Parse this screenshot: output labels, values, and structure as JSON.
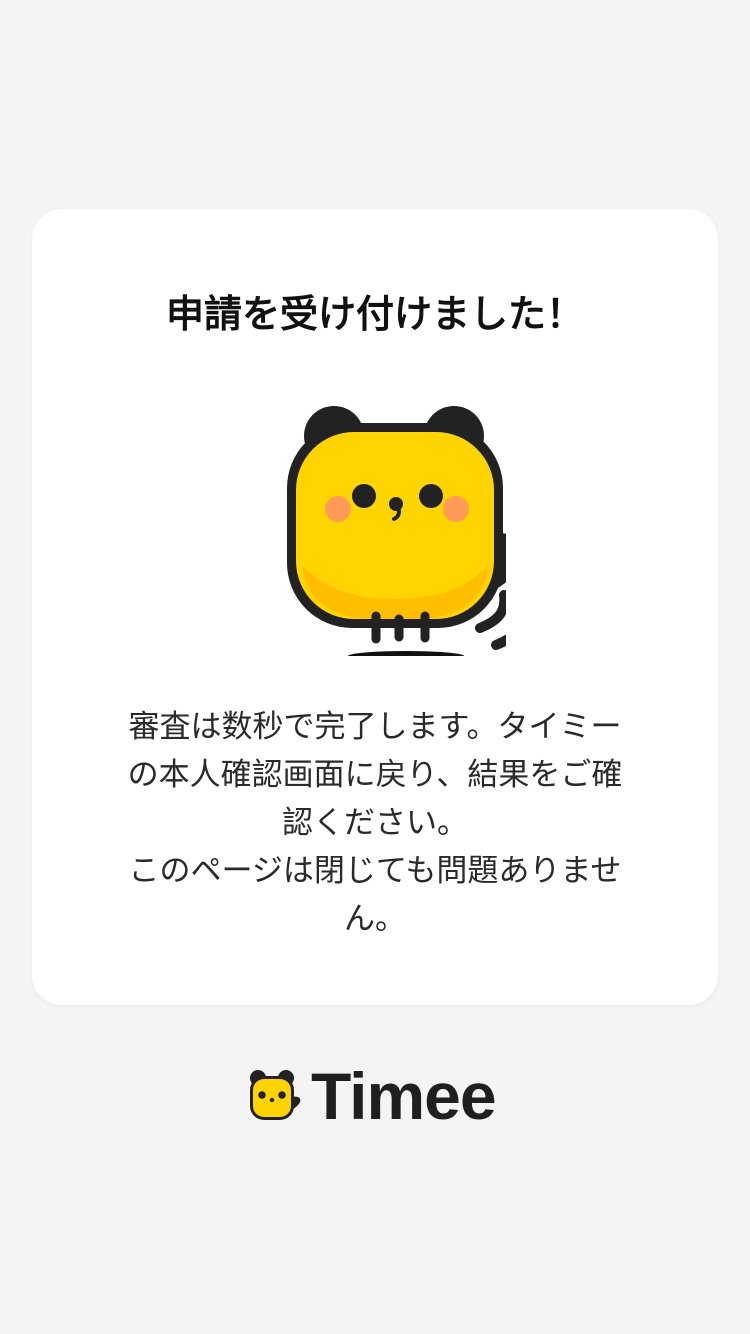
{
  "card": {
    "title": "申請を受け付けました！",
    "message_line1": "審査は数秒で完了します。タイミーの本人確認画面に戻り、結果をご確認ください。",
    "message_line2": "このページは閉じても問題ありません。"
  },
  "mascot": {
    "icon": "timee-mascot-icon",
    "body_color": "#ffd400",
    "outline_color": "#222222",
    "cheek_color": "#ff9b57"
  },
  "footer": {
    "brand_name": "Timee",
    "logo_icon": "timee-logo-icon"
  }
}
